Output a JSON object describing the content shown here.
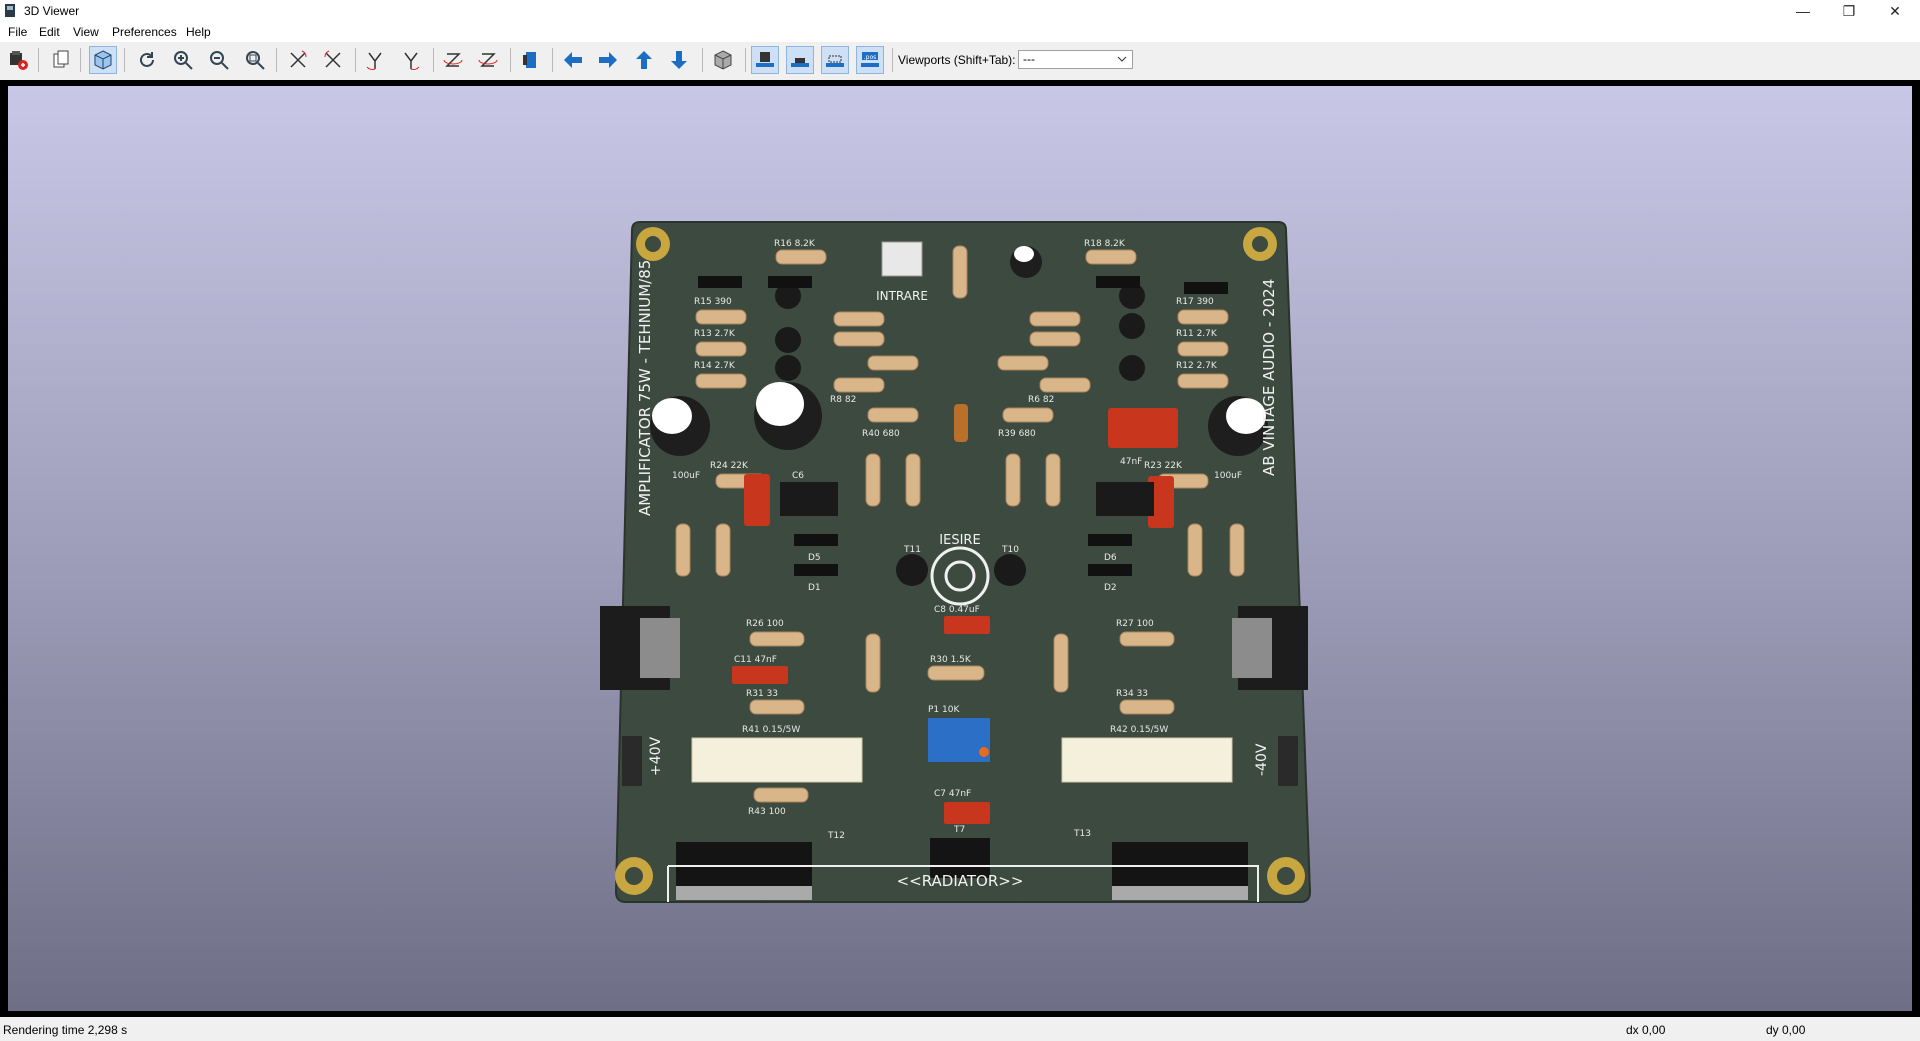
{
  "window": {
    "title": "3D Viewer",
    "minimize": "—",
    "restore": "❐",
    "close": "✕"
  },
  "menu": {
    "items": [
      "File",
      "Edit",
      "View",
      "Preferences",
      "Help"
    ]
  },
  "toolbar": {
    "buttons": [
      {
        "name": "export-icon"
      },
      {
        "name": "copy-icon"
      },
      {
        "name": "view-3d-icon"
      },
      {
        "name": "reload-icon"
      },
      {
        "name": "zoom-in-icon"
      },
      {
        "name": "zoom-out-icon"
      },
      {
        "name": "zoom-fit-icon"
      },
      {
        "name": "rotate-x-cw-icon"
      },
      {
        "name": "rotate-x-ccw-icon"
      },
      {
        "name": "rotate-y-cw-icon"
      },
      {
        "name": "rotate-y-ccw-icon"
      },
      {
        "name": "rotate-z-cw-icon"
      },
      {
        "name": "rotate-z-ccw-icon"
      },
      {
        "name": "flip-board-icon"
      },
      {
        "name": "move-left-icon"
      },
      {
        "name": "move-right-icon"
      },
      {
        "name": "move-up-icon"
      },
      {
        "name": "move-down-icon"
      },
      {
        "name": "ortho-icon"
      },
      {
        "name": "through-hole-icon"
      },
      {
        "name": "smd-icon"
      },
      {
        "name": "virtual-icon"
      },
      {
        "name": "not-in-pos-icon"
      }
    ],
    "viewports_label": "Viewports (Shift+Tab):",
    "viewports_value": "---"
  },
  "board": {
    "title_left": "AMPLIFICATOR 75W - TEHNIUM/85",
    "title_right": "AB VINTAGE AUDIO - 2024",
    "input_label": "INTRARE",
    "output_label": "IESIRE",
    "radiator_label": "<<RADIATOR>>",
    "plus_supply": "+40V",
    "minus_supply": "-40V",
    "silkscreen": [
      {
        "t": "R16  8.2K"
      },
      {
        "t": "R18  8.2K"
      },
      {
        "t": "R15   390"
      },
      {
        "t": "R17   390"
      },
      {
        "t": "R13   2.7K"
      },
      {
        "t": "R11   2.7K"
      },
      {
        "t": "R14   2.7K"
      },
      {
        "t": "R12   2.7K"
      },
      {
        "t": "R8        82"
      },
      {
        "t": "R6        82"
      },
      {
        "t": "R40   680"
      },
      {
        "t": "R39   680"
      },
      {
        "t": "100uF"
      },
      {
        "t": "100uF"
      },
      {
        "t": "R24     22K"
      },
      {
        "t": "R23     22K"
      },
      {
        "t": "C6"
      },
      {
        "t": "47nF"
      },
      {
        "t": "D5"
      },
      {
        "t": "D1"
      },
      {
        "t": "D6"
      },
      {
        "t": "D2"
      },
      {
        "t": "T11"
      },
      {
        "t": "T10"
      },
      {
        "t": "C8  0.47uF"
      },
      {
        "t": "R26     100"
      },
      {
        "t": "R27     100"
      },
      {
        "t": "C11  47nF"
      },
      {
        "t": "R30    1.5K"
      },
      {
        "t": "R31        33"
      },
      {
        "t": "R34        33"
      },
      {
        "t": "P1        10K"
      },
      {
        "t": "R41  0.15/5W"
      },
      {
        "t": "R42  0.15/5W"
      },
      {
        "t": "C7    47nF"
      },
      {
        "t": "R43      100"
      },
      {
        "t": "T12"
      },
      {
        "t": "T13"
      },
      {
        "t": "T7"
      }
    ]
  },
  "status": {
    "rendering": "Rendering time 2,298 s",
    "dx": "dx 0,00",
    "dy": "dy 0,00"
  }
}
